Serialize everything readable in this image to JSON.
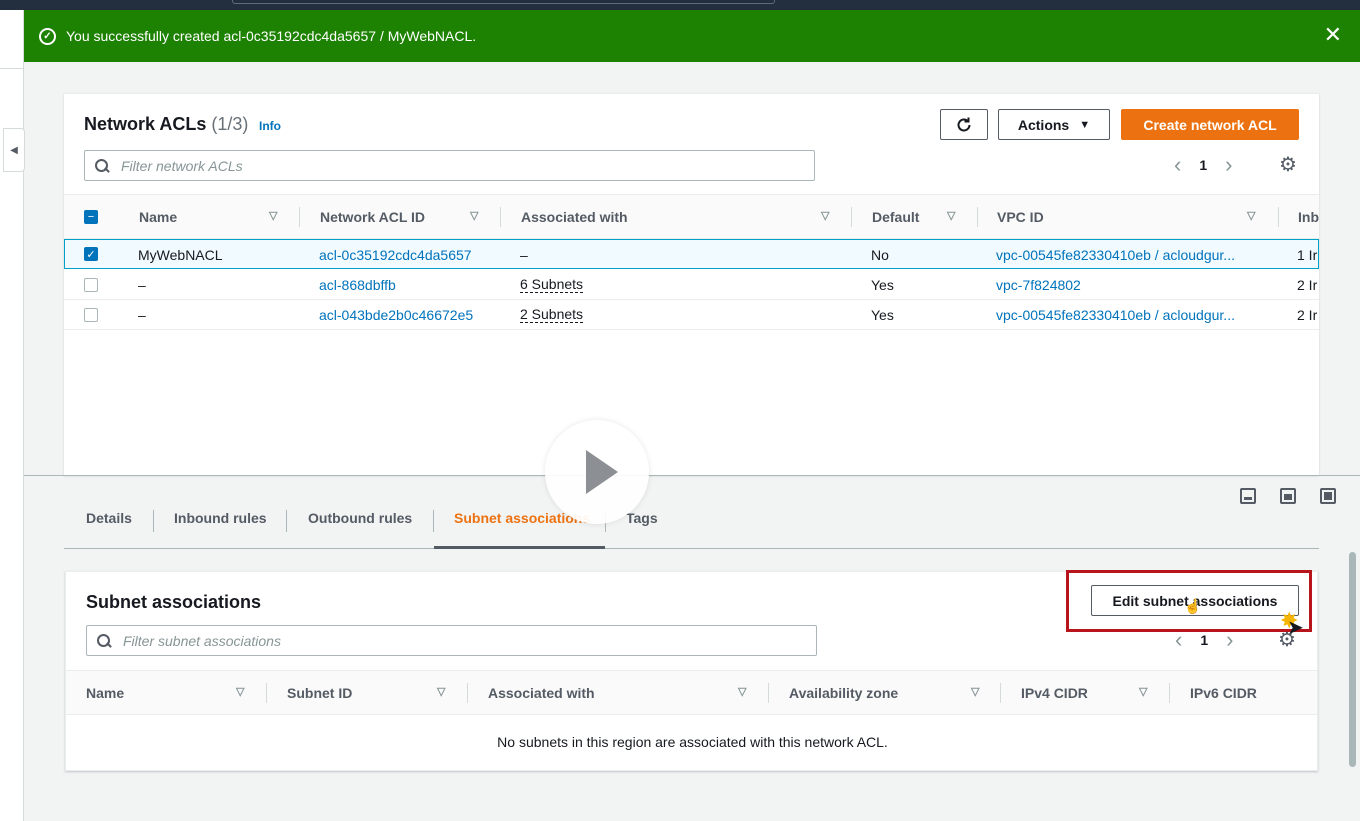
{
  "flash": {
    "message": "You successfully created acl-0c35192cdc4da5657 / MyWebNACL."
  },
  "network_acls": {
    "title": "Network ACLs",
    "count": "(1/3)",
    "info": "Info",
    "refresh_icon": "refresh-icon",
    "actions_label": "Actions",
    "create_label": "Create network ACL",
    "filter_placeholder": "Filter network ACLs",
    "page": "1",
    "columns": [
      "Name",
      "Network ACL ID",
      "Associated with",
      "Default",
      "VPC ID",
      "Inb"
    ],
    "rows": [
      {
        "selected": true,
        "name": "MyWebNACL",
        "acl_id": "acl-0c35192cdc4da5657",
        "associated": "–",
        "default": "No",
        "vpc": "vpc-00545fe82330410eb / acloudgur...",
        "inbound": "1 Ir"
      },
      {
        "selected": false,
        "name": "–",
        "acl_id": "acl-868dbffb",
        "associated": "6 Subnets",
        "default": "Yes",
        "vpc": "vpc-7f824802",
        "inbound": "2 Ir"
      },
      {
        "selected": false,
        "name": "–",
        "acl_id": "acl-043bde2b0c46672e5",
        "associated": "2 Subnets",
        "default": "Yes",
        "vpc": "vpc-00545fe82330410eb / acloudgur...",
        "inbound": "2 Ir"
      }
    ]
  },
  "tabs": [
    "Details",
    "Inbound rules",
    "Outbound rules",
    "Subnet associations",
    "Tags"
  ],
  "active_tab": "Subnet associations",
  "subnet_associations": {
    "title": "Subnet associations",
    "edit_label": "Edit subnet associations",
    "filter_placeholder": "Filter subnet associations",
    "page": "1",
    "columns": [
      "Name",
      "Subnet ID",
      "Associated with",
      "Availability zone",
      "IPv4 CIDR",
      "IPv6 CIDR"
    ],
    "empty_message": "No subnets in this region are associated with this network ACL."
  },
  "colors": {
    "success": "#1d8102",
    "primary": "#ec7211",
    "link": "#0073bb",
    "highlight_box": "#b8141b"
  }
}
